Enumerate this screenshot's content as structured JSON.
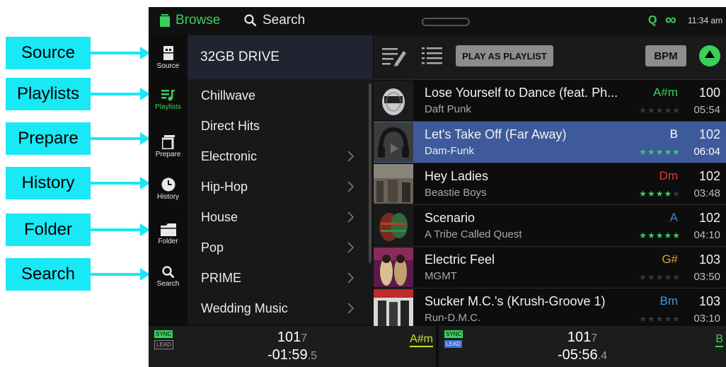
{
  "callouts": [
    {
      "label": "Source"
    },
    {
      "label": "Playlists"
    },
    {
      "label": "Prepare"
    },
    {
      "label": "History"
    },
    {
      "label": "Folder"
    },
    {
      "label": "Search"
    }
  ],
  "topbar": {
    "browse_label": "Browse",
    "search_label": "Search",
    "q_label": "Q",
    "link_icon": "∞",
    "time": "11:34 am"
  },
  "sidebar": {
    "items": [
      {
        "label": "Source",
        "icon": "usb-drive-icon"
      },
      {
        "label": "Playlists",
        "icon": "playlist-icon",
        "active": true
      },
      {
        "label": "Prepare",
        "icon": "prepare-icon"
      },
      {
        "label": "History",
        "icon": "clock-icon"
      },
      {
        "label": "Folder",
        "icon": "folder-icon"
      },
      {
        "label": "Search",
        "icon": "search-icon"
      }
    ]
  },
  "playlists": {
    "header": "32GB DRIVE",
    "items": [
      {
        "name": "Chillwave",
        "chevron": false
      },
      {
        "name": "Direct Hits",
        "chevron": false
      },
      {
        "name": "Electronic",
        "chevron": true
      },
      {
        "name": "Hip-Hop",
        "chevron": true
      },
      {
        "name": "House",
        "chevron": true
      },
      {
        "name": "Pop",
        "chevron": true
      },
      {
        "name": "PRIME",
        "chevron": true
      },
      {
        "name": "Wedding Music",
        "chevron": true
      }
    ]
  },
  "toolbar": {
    "play_as_playlist": "PLAY AS PLAYLIST",
    "bpm": "BPM"
  },
  "tracks": [
    {
      "title": "Lose Yourself to Dance (feat. Ph...",
      "artist": "Daft Punk",
      "key": "A#m",
      "key_color": "#37d05a",
      "bpm": "100",
      "time": "05:54",
      "rating": 0,
      "selected": false
    },
    {
      "title": "Let's Take Off (Far Away)",
      "artist": "Dam-Funk",
      "key": "B",
      "key_color": "#ffffff",
      "bpm": "102",
      "time": "06:04",
      "rating": 5,
      "selected": true
    },
    {
      "title": "Hey Ladies",
      "artist": "Beastie Boys",
      "key": "Dm",
      "key_color": "#e53935",
      "bpm": "102",
      "time": "03:48",
      "rating": 4,
      "selected": false
    },
    {
      "title": "Scenario",
      "artist": "A Tribe Called Quest",
      "key": "A",
      "key_color": "#3b82c4",
      "bpm": "102",
      "time": "04:10",
      "rating": 5,
      "selected": false
    },
    {
      "title": "Electric Feel",
      "artist": "MGMT",
      "key": "G#",
      "key_color": "#e0a020",
      "bpm": "103",
      "time": "03:50",
      "rating": 0,
      "selected": false
    },
    {
      "title": "Sucker M.C.'s (Krush-Groove 1)",
      "artist": "Run-D.M.C.",
      "key": "Bm",
      "key_color": "#3b9be0",
      "bpm": "103",
      "time": "03:10",
      "rating": 0,
      "selected": false
    }
  ],
  "decks": [
    {
      "sync": "SYNC",
      "lead": "LEAD",
      "lead_active": false,
      "bpm_int": "101",
      "bpm_dec": "7",
      "time_main": "-01:59",
      "time_dec": ".5",
      "key": "A#m",
      "key_color": "#c6e21a"
    },
    {
      "sync": "SYNC",
      "lead": "LEAD",
      "lead_active": true,
      "bpm_int": "101",
      "bpm_dec": "7",
      "time_main": "-05:56",
      "time_dec": ".4",
      "key": "B",
      "key_color": "#37d05a"
    }
  ],
  "colors": {
    "accent_green": "#37d05a",
    "callout_cyan": "#19e8f5",
    "selected_row": "#3e5a9a",
    "star_on": "#37d05a",
    "star_off": "#3a3a3a"
  }
}
